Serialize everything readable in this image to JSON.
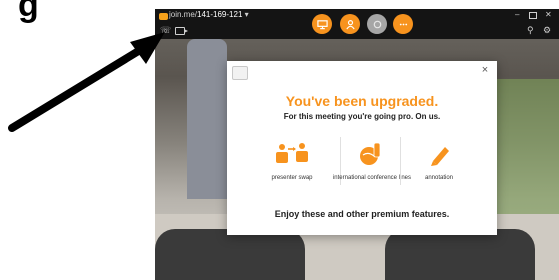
{
  "heading_fragment": "g",
  "window": {
    "title_prefix": "join.me/",
    "meeting_id": "141-169-121",
    "title_caret": "▾"
  },
  "toolbar": {
    "buttons": [
      {
        "name": "screen-share-button",
        "color": "#f7931e"
      },
      {
        "name": "people-button",
        "color": "#f7931e"
      },
      {
        "name": "record-button",
        "color": "#a6a6a6"
      },
      {
        "name": "more-button",
        "color": "#f7931e"
      }
    ]
  },
  "modal": {
    "headline": "You've been upgraded.",
    "subline": "For this meeting you're going pro. On us.",
    "features": [
      {
        "label": "presenter swap",
        "icon": "presenter-swap-icon"
      },
      {
        "label": "international conference lines",
        "icon": "globe-phone-icon"
      },
      {
        "label": "annotation",
        "icon": "pencil-icon"
      }
    ],
    "footer": "Enjoy these and other premium features.",
    "close_label": "×"
  },
  "colors": {
    "accent": "#f7931e",
    "titlebar": "#141414"
  }
}
